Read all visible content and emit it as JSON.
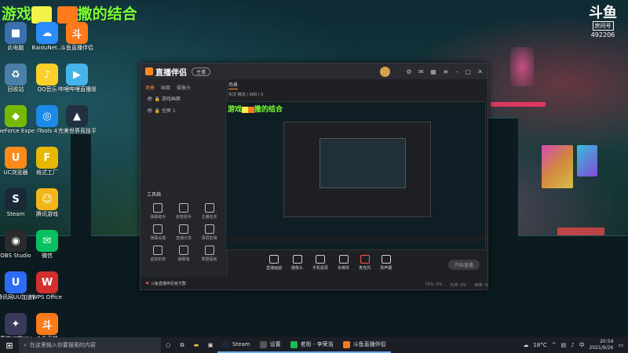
{
  "overlay": {
    "title_part1": "游戏",
    "title_part2": "撒的结合"
  },
  "brand_logo": {
    "text": "斗鱼",
    "room_label": "房间号",
    "room_number": "492206"
  },
  "desktop_icons": [
    {
      "label": "此电脑",
      "color": "#3b6fb0",
      "glyph": "■"
    },
    {
      "label": "BaiduNet...",
      "color": "#2a8cff",
      "glyph": "☁"
    },
    {
      "label": "斗鱼直播伴侣",
      "color": "#ff7a1a",
      "glyph": "斗"
    },
    {
      "label": "回收站",
      "color": "#4a7fa8",
      "glyph": "♻"
    },
    {
      "label": "QQ音乐",
      "color": "#ffcf2a",
      "glyph": "♪"
    },
    {
      "label": "哔哩哔哩直播姬",
      "color": "#45b4ea",
      "glyph": "▶"
    },
    {
      "label": "GeForce Experience",
      "color": "#76b900",
      "glyph": "◆"
    },
    {
      "label": "iTools 4",
      "color": "#1d8ae8",
      "glyph": "◎"
    },
    {
      "label": "完美世界竞技平台",
      "color": "#223040",
      "glyph": "▲"
    },
    {
      "label": "UC浏览器",
      "color": "#ff8a1a",
      "glyph": "U"
    },
    {
      "label": "格式工厂",
      "color": "#e6b800",
      "glyph": "F"
    },
    {
      "label": "Steam",
      "color": "#1b2838",
      "glyph": "S"
    },
    {
      "label": "腾讯游戏",
      "color": "#f2b61a",
      "glyph": "☺"
    },
    {
      "label": "OBS Studio",
      "color": "#2b2b2b",
      "glyph": "◉"
    },
    {
      "label": "微信",
      "color": "#07c160",
      "glyph": "✉"
    },
    {
      "label": "腾讯网UU加速器",
      "color": "#2d6df5",
      "glyph": "U"
    },
    {
      "label": "WPS Office",
      "color": "#d32f2f",
      "glyph": "W"
    },
    {
      "label": "黑暗幻想XIV",
      "color": "#3a3a5a",
      "glyph": "✦"
    },
    {
      "label": "斗鱼直播",
      "color": "#ff7a1a",
      "glyph": "斗"
    }
  ],
  "app": {
    "name": "直播伴侣",
    "badge": "主播",
    "left_tabs": [
      "场景",
      "画面",
      "摄像头"
    ],
    "scene_rows": [
      "游戏画面",
      "全屏 1"
    ],
    "toolbox_title": "工具箱",
    "tools": [
      "弹幕助手",
      "房管助手",
      "主播任务",
      "弹幕设置",
      "直播分享",
      "录屏剪辑",
      "虚拟形象",
      "弹幕墙",
      "数据看板"
    ],
    "footer_text": "斗鱼直播伴侣官方群",
    "preview_tab": "场景",
    "stats": "实况 推流 | 0KB | 0",
    "controls": [
      "直播画面",
      "摄像头",
      "手机投屏",
      "多媒体",
      "麦克风",
      "扬声器"
    ],
    "start_label": "开始直播",
    "status_items": [
      "CPU: 0%",
      "内存: 0%",
      "帧率: 0"
    ]
  },
  "taskbar": {
    "search_placeholder": "在这里输入你要搜索的内容",
    "apps": [
      {
        "label": "Steam",
        "color": "#1b2838"
      },
      {
        "label": "设置",
        "color": "#555"
      },
      {
        "label": "老街 - 李荣浩",
        "color": "#1db954"
      },
      {
        "label": "斗鱼直播伴侣",
        "color": "#ff7a1a"
      }
    ],
    "weather": "18°C",
    "time": "20:54",
    "date": "2021/9/26"
  }
}
